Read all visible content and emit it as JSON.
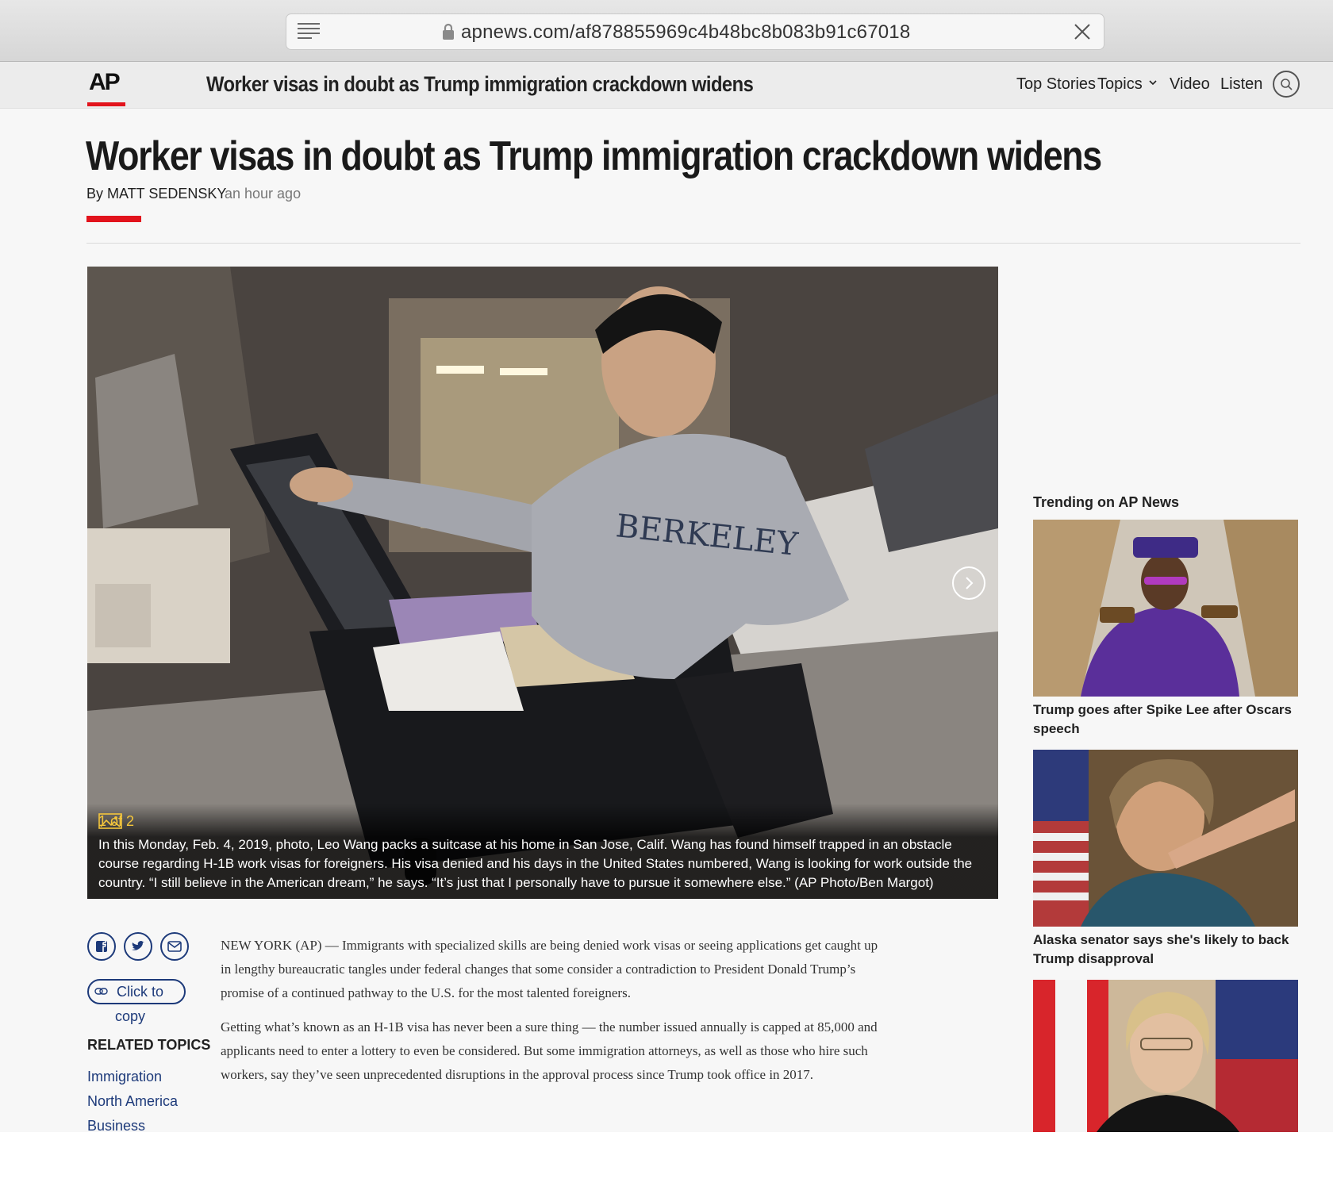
{
  "browser": {
    "url": "apnews.com/af878855969c4b48bc8b083b91c67018"
  },
  "header": {
    "logo": "AP",
    "title": "Worker visas in doubt as Trump immigration crackdown widens",
    "nav": {
      "top_stories": "Top Stories",
      "topics": "Topics",
      "video": "Video",
      "listen": "Listen"
    }
  },
  "article": {
    "headline": "Worker visas in doubt as Trump immigration crackdown widens",
    "byline": "By MATT SEDENSKY",
    "timestamp": "an hour ago",
    "photo": {
      "counter": "1 of 2",
      "caption": "In this Monday, Feb. 4, 2019, photo, Leo Wang packs a suitcase at his home in San Jose, Calif. Wang has found himself trapped in an obstacle course regarding H-1B work visas for foreigners. His visa denied and his days in the United States numbered, Wang is looking for work outside the country. “I still believe in the American dream,” he says. “It’s just that I personally have to pursue it somewhere else.” (AP Photo/Ben Margot)"
    },
    "paragraphs": [
      "NEW YORK (AP) — Immigrants with specialized skills are being denied work visas or seeing applications get caught up in lengthy bureaucratic tangles under federal changes that some consider a contradiction to President Donald Trump’s promise of a continued pathway to the U.S. for the most talented foreigners.",
      "Getting what’s known as an H-1B visa has never been a sure thing — the number issued annually is capped at 85,000 and applicants need to enter a lottery to even be considered. But some immigration attorneys, as well as those who hire such workers, say they’ve seen unprecedented disruptions in the approval process since Trump took office in 2017."
    ]
  },
  "share": {
    "copy_label_1": "Click to",
    "copy_label_2": "copy"
  },
  "related": {
    "title": "RELATED TOPICS",
    "links": [
      "Immigration",
      "North America",
      "Business"
    ]
  },
  "trending": {
    "title": "Trending on AP News",
    "items": [
      {
        "caption": "Trump goes after Spike Lee after Oscars speech"
      },
      {
        "caption": "Alaska senator says she's likely to back Trump disapproval"
      }
    ]
  },
  "colors": {
    "accent_red": "#e2131c",
    "link_blue": "#1d3a7a",
    "caption_counter": "#f3c53c"
  }
}
